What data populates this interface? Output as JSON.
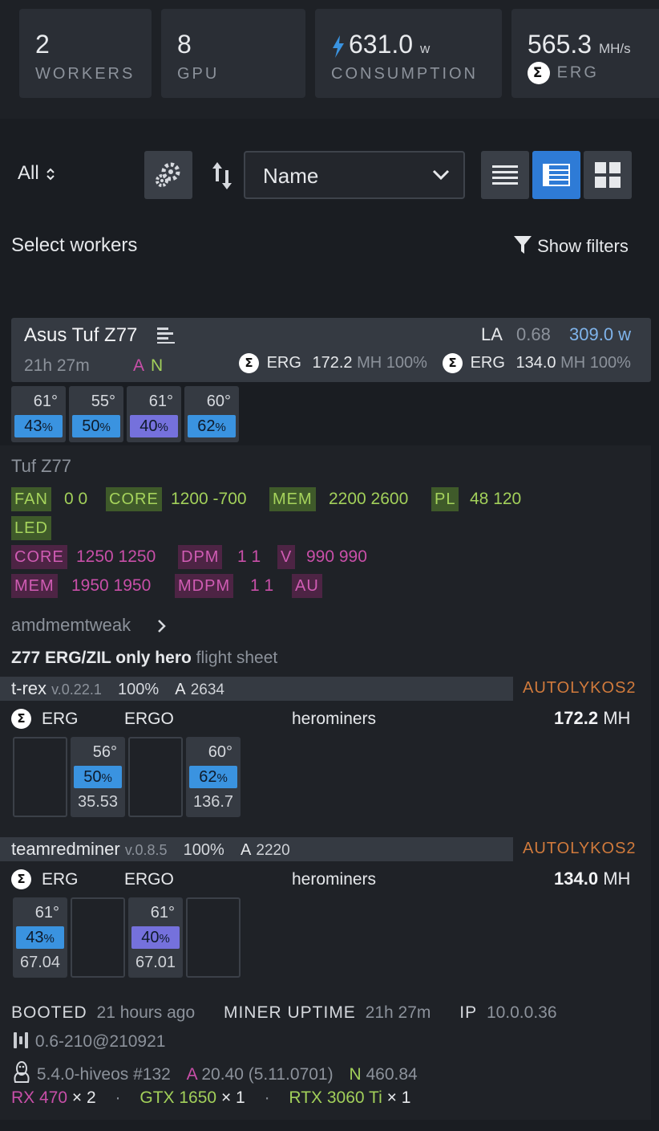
{
  "stats": {
    "workers": {
      "value": "2",
      "label": "WORKERS"
    },
    "gpu": {
      "value": "8",
      "label": "GPU"
    },
    "consumption": {
      "value": "631.0",
      "unit": "w",
      "label": "CONSUMPTION"
    },
    "hashrate": {
      "value": "565.3",
      "unit": "MH/s",
      "label": "ERG"
    }
  },
  "toolbar": {
    "filter_all": "All",
    "sort_field": "Name",
    "select_workers": "Select workers",
    "show_filters": "Show filters"
  },
  "worker": {
    "name": "Asus Tuf Z77",
    "uptime": "21h 27m",
    "flag_a": "A",
    "flag_n": "N",
    "la_label": "LA",
    "la_value": "0.68",
    "power": "309.0 w",
    "miners_summary": [
      {
        "coin": "ERG",
        "hash": "172.2",
        "unit": "MH",
        "pct": "100%"
      },
      {
        "coin": "ERG",
        "hash": "134.0",
        "unit": "MH",
        "pct": "100%"
      }
    ],
    "gpus": [
      {
        "temp": "61°",
        "fan": "43",
        "color": "#3a93e0"
      },
      {
        "temp": "55°",
        "fan": "50",
        "color": "#3a93e0"
      },
      {
        "temp": "61°",
        "fan": "40",
        "color": "#7571dc"
      },
      {
        "temp": "60°",
        "fan": "62",
        "color": "#3a93e0"
      }
    ],
    "overclock_title": "Tuf Z77",
    "nvidia_oc": {
      "fan_label": "FAN",
      "fan": "0 0",
      "core_label": "CORE",
      "core": "1200 -700",
      "mem_label": "MEM",
      "mem": "2200 2600",
      "pl_label": "PL",
      "pl": "48 120",
      "led_label": "LED"
    },
    "amd_oc": {
      "core_label": "CORE",
      "core": "1250 1250",
      "dpm_label": "DPM",
      "dpm": "1 1",
      "v_label": "V",
      "v": "990 990",
      "mem_label": "MEM",
      "mem": "1950 1950",
      "mdpm_label": "MDPM",
      "mdpm": "1 1",
      "au_label": "AU"
    },
    "amdmemtweak": "amdmemtweak",
    "flight_sheet_name": "Z77 ERG/ZIL only hero",
    "flight_sheet_suffix": "flight sheet",
    "miners": [
      {
        "name": "t-rex",
        "version": "v.0.22.1",
        "pct": "100%",
        "a_label": "A",
        "accepted": "2634",
        "algo": "AUTOLYKOS2",
        "coin": "ERG",
        "wallet": "ERGO",
        "pool": "herominers",
        "hash": "172.2",
        "unit": "MH",
        "gpus": [
          {
            "empty": true
          },
          {
            "temp": "56°",
            "fan": "50",
            "hash": "35.53",
            "color": "#3a93e0"
          },
          {
            "empty": true
          },
          {
            "temp": "60°",
            "fan": "62",
            "hash": "136.7",
            "color": "#3a93e0"
          }
        ]
      },
      {
        "name": "teamredminer",
        "version": "v.0.8.5",
        "pct": "100%",
        "a_label": "A",
        "accepted": "2220",
        "algo": "AUTOLYKOS2",
        "coin": "ERG",
        "wallet": "ERGO",
        "pool": "herominers",
        "hash": "134.0",
        "unit": "MH",
        "gpus": [
          {
            "temp": "61°",
            "fan": "43",
            "hash": "67.04",
            "color": "#3a93e0"
          },
          {
            "empty": true
          },
          {
            "temp": "61°",
            "fan": "40",
            "hash": "67.01",
            "color": "#7571dc"
          },
          {
            "empty": true
          }
        ]
      }
    ],
    "booted_label": "BOOTED",
    "booted": "21 hours ago",
    "miner_uptime_label": "MINER UPTIME",
    "miner_uptime": "21h 27m",
    "ip_label": "IP",
    "ip": "10.0.0.36",
    "hive_version": "0.6-210@210921",
    "kernel": "5.4.0-hiveos #132",
    "amd_driver_label": "A",
    "amd_driver": "20.40 (5.11.0701)",
    "nvidia_driver_label": "N",
    "nvidia_driver": "460.84",
    "cards": [
      {
        "model": "RX 470",
        "count": "× 2",
        "color": "#c84fa8"
      },
      {
        "model": "GTX 1650",
        "count": "× 1",
        "color": "#a2d05a"
      },
      {
        "model": "RTX 3060 Ti",
        "count": "× 1",
        "color": "#a2d05a"
      }
    ]
  },
  "icon_names": [
    "lightning-icon",
    "erg-icon",
    "chevron-updown-icon",
    "gears-icon",
    "sort-icon",
    "chevron-down-icon",
    "view-list-icon",
    "view-table-icon",
    "view-grid-icon",
    "filter-icon",
    "worker-menu-icon",
    "chevron-right-icon",
    "hive-icon",
    "linux-icon"
  ]
}
